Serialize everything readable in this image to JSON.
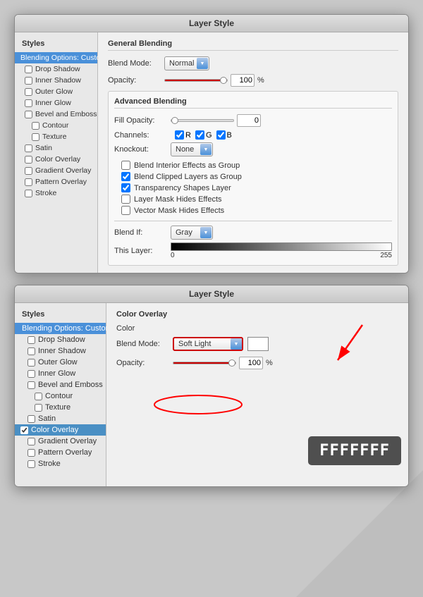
{
  "top_dialog": {
    "title": "Layer Style",
    "sidebar": {
      "heading": "Styles",
      "items": [
        {
          "label": "Blending Options: Custom",
          "type": "section-header",
          "active": true
        },
        {
          "label": "Drop Shadow",
          "type": "checkbox",
          "checked": false
        },
        {
          "label": "Inner Shadow",
          "type": "checkbox",
          "checked": false
        },
        {
          "label": "Outer Glow",
          "type": "checkbox",
          "checked": false
        },
        {
          "label": "Inner Glow",
          "type": "checkbox",
          "checked": false
        },
        {
          "label": "Bevel and Emboss",
          "type": "checkbox",
          "checked": false
        },
        {
          "label": "Contour",
          "type": "checkbox-sub",
          "checked": false
        },
        {
          "label": "Texture",
          "type": "checkbox-sub",
          "checked": false
        },
        {
          "label": "Satin",
          "type": "checkbox",
          "checked": false
        },
        {
          "label": "Color Overlay",
          "type": "checkbox",
          "checked": false
        },
        {
          "label": "Gradient Overlay",
          "type": "checkbox",
          "checked": false
        },
        {
          "label": "Pattern Overlay",
          "type": "checkbox",
          "checked": false
        },
        {
          "label": "Stroke",
          "type": "checkbox",
          "checked": false
        }
      ]
    },
    "panel": {
      "general_blending_title": "General Blending",
      "blend_mode_label": "Blend Mode:",
      "blend_mode_value": "Normal",
      "opacity_label": "Opacity:",
      "opacity_value": "100",
      "opacity_percent": "%",
      "advanced_blending_title": "Advanced Blending",
      "fill_opacity_label": "Fill Opacity:",
      "fill_opacity_value": "0",
      "channels_label": "Channels:",
      "channels": [
        "R",
        "G",
        "B"
      ],
      "knockout_label": "Knockout:",
      "knockout_value": "None",
      "checkboxes": [
        {
          "label": "Blend Interior Effects as Group",
          "checked": false
        },
        {
          "label": "Blend Clipped Layers as Group",
          "checked": true
        },
        {
          "label": "Transparency Shapes Layer",
          "checked": true
        },
        {
          "label": "Layer Mask Hides Effects",
          "checked": false
        },
        {
          "label": "Vector Mask Hides Effects",
          "checked": false
        }
      ],
      "blend_if_label": "Blend If:",
      "blend_if_value": "Gray",
      "this_layer_label": "This Layer:",
      "this_layer_min": "0",
      "this_layer_max": "255"
    }
  },
  "bottom_dialog": {
    "title": "Layer Style",
    "sidebar": {
      "heading": "Styles",
      "items": [
        {
          "label": "Blending Options: Custom",
          "type": "section-header",
          "active": false
        },
        {
          "label": "Drop Shadow",
          "type": "checkbox",
          "checked": false
        },
        {
          "label": "Inner Shadow",
          "type": "checkbox",
          "checked": false
        },
        {
          "label": "Outer Glow",
          "type": "checkbox",
          "checked": false
        },
        {
          "label": "Inner Glow",
          "type": "checkbox",
          "checked": false
        },
        {
          "label": "Bevel and Emboss",
          "type": "checkbox",
          "checked": false
        },
        {
          "label": "Contour",
          "type": "checkbox-sub",
          "checked": false
        },
        {
          "label": "Texture",
          "type": "checkbox-sub",
          "checked": false
        },
        {
          "label": "Satin",
          "type": "checkbox",
          "checked": false
        },
        {
          "label": "Color Overlay",
          "type": "checkbox-active",
          "checked": true
        },
        {
          "label": "Gradient Overlay",
          "type": "checkbox",
          "checked": false
        },
        {
          "label": "Pattern Overlay",
          "type": "checkbox",
          "checked": false
        },
        {
          "label": "Stroke",
          "type": "checkbox",
          "checked": false
        }
      ]
    },
    "panel": {
      "section_title": "Color Overlay",
      "color_subsection": "Color",
      "blend_mode_label": "Blend Mode:",
      "blend_mode_value": "Soft Light",
      "opacity_label": "Opacity:",
      "opacity_value": "100",
      "opacity_percent": "%",
      "color_code": "FFFFFFF"
    },
    "annotations": {
      "color_badge": "FFFFFFF",
      "arrow_note": "red arrow pointing to blend mode dropdown"
    }
  }
}
